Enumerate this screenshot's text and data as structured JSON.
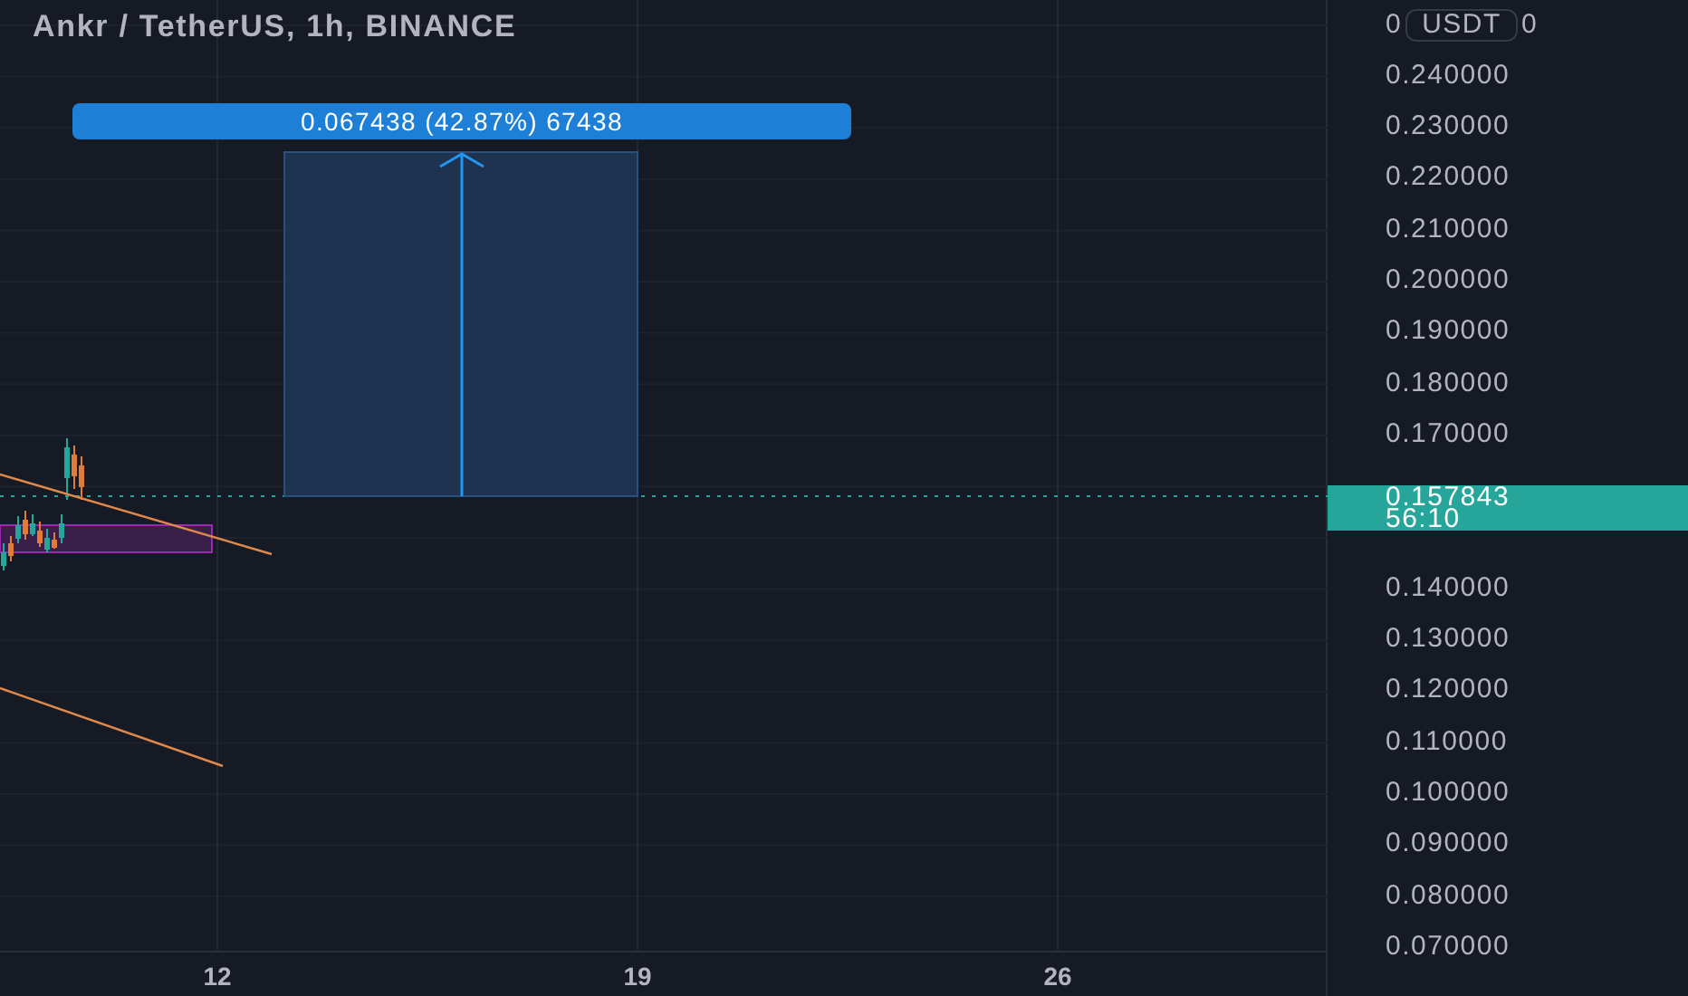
{
  "chart_title": "Ankr / TetherUS, 1h, BINANCE",
  "measure_label": "0.067438 (42.87%) 67438",
  "price_axis": {
    "top_label_parts": [
      "0",
      "0"
    ],
    "currency_badge": "USDT",
    "ticks_above_price": [
      "0.240000",
      "0.230000",
      "0.220000",
      "0.210000",
      "0.200000",
      "0.190000",
      "0.180000",
      "0.170000"
    ],
    "ticks_below_price": [
      "0.140000",
      "0.130000",
      "0.120000",
      "0.110000",
      "0.100000",
      "0.090000",
      "0.080000",
      "0.070000"
    ]
  },
  "current_price": {
    "price": "0.157843",
    "countdown": "56:10"
  },
  "time_axis": [
    "12",
    "19",
    "26"
  ]
}
